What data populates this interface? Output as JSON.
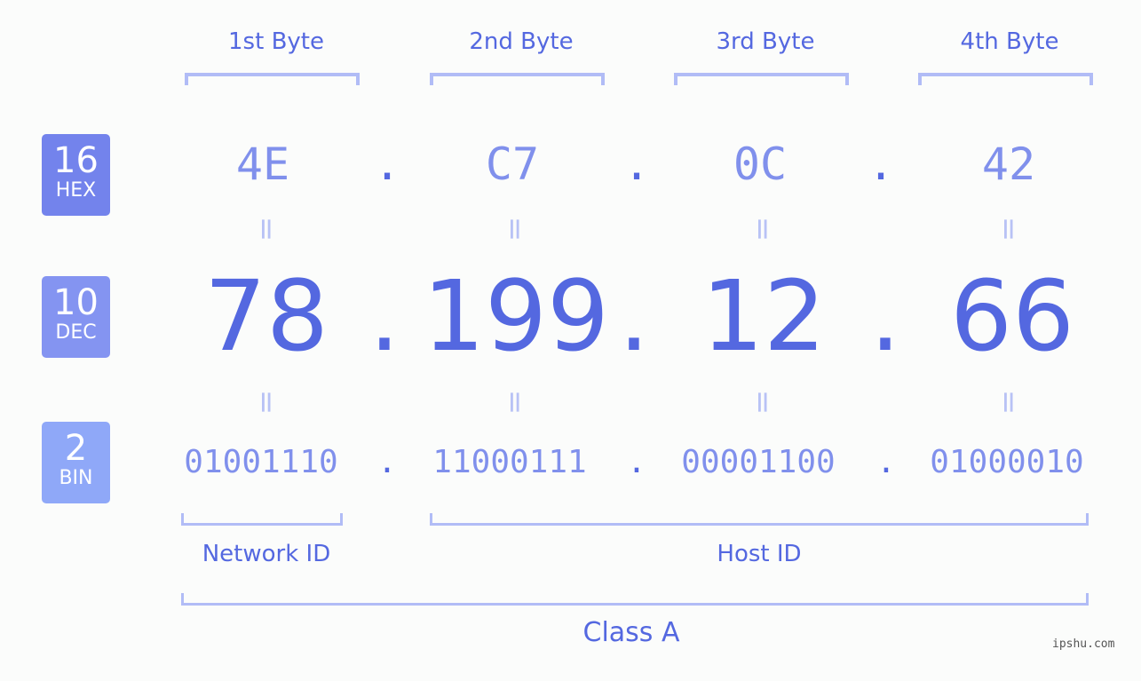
{
  "bytes": [
    {
      "label": "1st Byte",
      "hex": "4E",
      "dec": "78",
      "bin": "01001110"
    },
    {
      "label": "2nd Byte",
      "hex": "C7",
      "dec": "199",
      "bin": "11000111"
    },
    {
      "label": "3rd Byte",
      "hex": "0C",
      "dec": "12",
      "bin": "00001100"
    },
    {
      "label": "4th Byte",
      "hex": "42",
      "dec": "66",
      "bin": "01000010"
    }
  ],
  "separator": ".",
  "equals": "=",
  "badges": {
    "hex": {
      "num": "16",
      "label": "HEX",
      "color": "#7383ec"
    },
    "dec": {
      "num": "10",
      "label": "DEC",
      "color": "#8494f1"
    },
    "bin": {
      "num": "2",
      "label": "BIN",
      "color": "#8fa8f8"
    }
  },
  "network_id": "Network ID",
  "host_id": "Host ID",
  "class": "Class A",
  "watermark": "ipshu.com",
  "colors": {
    "accent": "#5468e0",
    "light": "#8090ec",
    "bracket": "#b1bcf6"
  }
}
